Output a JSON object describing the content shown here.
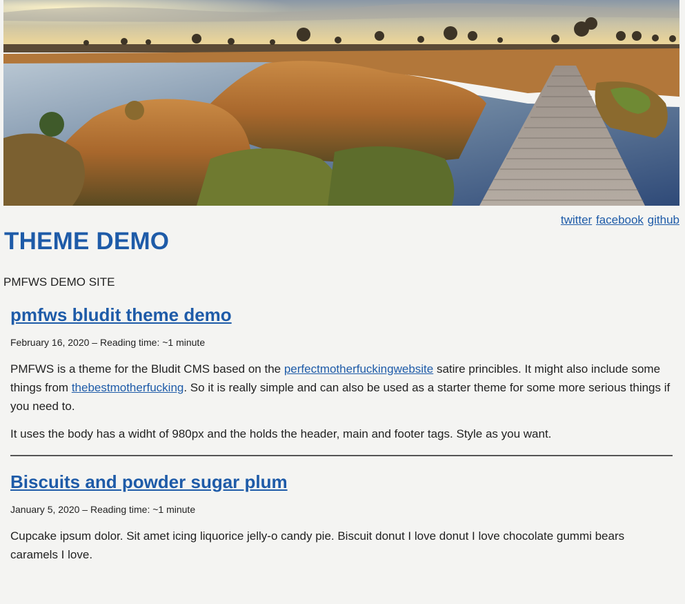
{
  "header": {
    "banner_image": "landscape-boardwalk-marsh",
    "social_links": [
      {
        "label": "twitter"
      },
      {
        "label": "facebook"
      },
      {
        "label": "github"
      }
    ],
    "site_title": "THEME DEMO",
    "tagline": "PMFWS DEMO SITE"
  },
  "posts": [
    {
      "title": "pmfws bludit theme demo",
      "meta": "February 16, 2020 – Reading time: ~1 minute",
      "p1_before": "PMFWS is a theme for the Bludit CMS based on the ",
      "p1_link1": "perfectmotherfuckingwebsite",
      "p1_middle": " satire princibles. It might also include some things from ",
      "p1_link2": "thebestmotherfucking",
      "p1_after": ". So it is really simple and can also be used as a starter theme for some more serious things if you need to.",
      "p2": "It uses the body has a widht of 980px and the holds the header, main and footer tags. Style as you want."
    },
    {
      "title": "Biscuits and powder sugar plum",
      "meta": "January 5, 2020 – Reading time: ~1 minute",
      "p1": "Cupcake ipsum dolor. Sit amet icing liquorice jelly-o candy pie. Biscuit donut I love donut I love chocolate gummi bears caramels I love."
    }
  ],
  "colors": {
    "link": "#1e5ba8",
    "background": "#f4f4f2",
    "text": "#222222"
  }
}
